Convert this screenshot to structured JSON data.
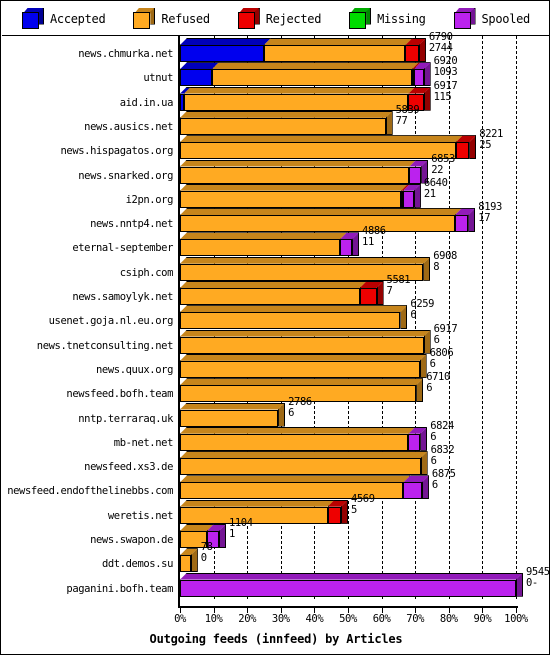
{
  "legend": {
    "items": [
      {
        "label": "Accepted",
        "color": "#0000ee",
        "icon": "cube-icon"
      },
      {
        "label": "Refused",
        "color": "#ffaa22",
        "icon": "cube-icon"
      },
      {
        "label": "Rejected",
        "color": "#ee0000",
        "icon": "cube-icon"
      },
      {
        "label": "Missing",
        "color": "#00dd00",
        "icon": "cube-icon"
      },
      {
        "label": "Spooled",
        "color": "#bb22ee",
        "icon": "cube-icon"
      }
    ]
  },
  "axis": {
    "x_title": "Outgoing feeds (innfeed) by Articles",
    "x_ticks": [
      "0%",
      "10%",
      "20%",
      "30%",
      "40%",
      "50%",
      "60%",
      "70%",
      "80%",
      "90%",
      "100%"
    ]
  },
  "chart_data": {
    "type": "bar",
    "orientation": "horizontal",
    "stacked": true,
    "title": "Outgoing feeds (innfeed) by Articles",
    "xlabel": "Outgoing feeds (innfeed) by Articles",
    "ylabel": "",
    "xlim": [
      0,
      100
    ],
    "xtick_labels": [
      "0%",
      "10%",
      "20%",
      "30%",
      "40%",
      "50%",
      "60%",
      "70%",
      "80%",
      "90%",
      "100%"
    ],
    "xtick_values": [
      0,
      10,
      20,
      30,
      40,
      50,
      60,
      70,
      80,
      90,
      100
    ],
    "grid": true,
    "grid_axis": "x",
    "legend_position": "top",
    "series": [
      {
        "name": "Accepted",
        "color": "#0000ee"
      },
      {
        "name": "Refused",
        "color": "#ffaa22"
      },
      {
        "name": "Rejected",
        "color": "#ee0000"
      },
      {
        "name": "Missing",
        "color": "#00dd00"
      },
      {
        "name": "Spooled",
        "color": "#bb22ee"
      }
    ],
    "categories": [
      "news.chmurka.net",
      "utnut",
      "aid.in.ua",
      "news.ausics.net",
      "news.hispagatos.org",
      "news.snarked.org",
      "i2pn.org",
      "news.nntp4.net",
      "eternal-september",
      "csiph.com",
      "news.samoylyk.net",
      "usenet.goja.nl.eu.org",
      "news.tnetconsulting.net",
      "news.quux.org",
      "newsfeed.bofh.team",
      "nntp.terraraq.uk",
      "mb-net.net",
      "newsfeed.xs3.de",
      "newsfeed.endofthelinebbs.com",
      "weretis.net",
      "news.swapon.de",
      "ddt.demos.su",
      "paganini.bofh.team"
    ],
    "rows": [
      {
        "category": "news.chmurka.net",
        "label_top": "6790",
        "label_bottom": "2744",
        "total_pct": 71.1,
        "segments": [
          {
            "series": "Accepted",
            "pct": 25.0
          },
          {
            "series": "Refused",
            "pct": 42.1
          },
          {
            "series": "Rejected",
            "pct": 4.0
          }
        ]
      },
      {
        "category": "utnut",
        "label_top": "6920",
        "label_bottom": "1093",
        "total_pct": 72.5,
        "segments": [
          {
            "series": "Accepted",
            "pct": 9.5
          },
          {
            "series": "Refused",
            "pct": 59.5
          },
          {
            "series": "Rejected",
            "pct": 0.6
          },
          {
            "series": "Spooled",
            "pct": 2.9
          }
        ]
      },
      {
        "category": "aid.in.ua",
        "label_top": "6917",
        "label_bottom": "115",
        "total_pct": 72.5,
        "segments": [
          {
            "series": "Accepted",
            "pct": 1.2
          },
          {
            "series": "Refused",
            "pct": 66.8
          },
          {
            "series": "Rejected",
            "pct": 4.5
          }
        ]
      },
      {
        "category": "news.ausics.net",
        "label_top": "5839",
        "label_bottom": "77",
        "total_pct": 61.2,
        "segments": [
          {
            "series": "Refused",
            "pct": 61.2
          }
        ]
      },
      {
        "category": "news.hispagatos.org",
        "label_top": "8221",
        "label_bottom": "25",
        "total_pct": 86.1,
        "segments": [
          {
            "series": "Refused",
            "pct": 82.1
          },
          {
            "series": "Rejected",
            "pct": 4.0
          }
        ]
      },
      {
        "category": "news.snarked.org",
        "label_top": "6853",
        "label_bottom": "22",
        "total_pct": 71.8,
        "segments": [
          {
            "series": "Refused",
            "pct": 68.3
          },
          {
            "series": "Spooled",
            "pct": 3.5
          }
        ]
      },
      {
        "category": "i2pn.org",
        "label_top": "6640",
        "label_bottom": "21",
        "total_pct": 69.6,
        "segments": [
          {
            "series": "Refused",
            "pct": 65.8
          },
          {
            "series": "Rejected",
            "pct": 0.6
          },
          {
            "series": "Spooled",
            "pct": 3.2
          }
        ]
      },
      {
        "category": "news.nntp4.net",
        "label_top": "8193",
        "label_bottom": "17",
        "total_pct": 85.8,
        "segments": [
          {
            "series": "Refused",
            "pct": 81.8
          },
          {
            "series": "Spooled",
            "pct": 4.0
          }
        ]
      },
      {
        "category": "eternal-september",
        "label_top": "4886",
        "label_bottom": "11",
        "total_pct": 51.2,
        "segments": [
          {
            "series": "Refused",
            "pct": 47.6
          },
          {
            "series": "Spooled",
            "pct": 3.6
          }
        ]
      },
      {
        "category": "csiph.com",
        "label_top": "6908",
        "label_bottom": "8",
        "total_pct": 72.4,
        "segments": [
          {
            "series": "Refused",
            "pct": 72.4
          }
        ]
      },
      {
        "category": "news.samoylyk.net",
        "label_top": "5581",
        "label_bottom": "7",
        "total_pct": 58.5,
        "segments": [
          {
            "series": "Refused",
            "pct": 53.5
          },
          {
            "series": "Rejected",
            "pct": 5.0
          }
        ]
      },
      {
        "category": "usenet.goja.nl.eu.org",
        "label_top": "6259",
        "label_bottom": "6",
        "total_pct": 65.6,
        "segments": [
          {
            "series": "Refused",
            "pct": 65.6
          }
        ]
      },
      {
        "category": "news.tnetconsulting.net",
        "label_top": "6917",
        "label_bottom": "6",
        "total_pct": 72.5,
        "segments": [
          {
            "series": "Refused",
            "pct": 72.5
          }
        ]
      },
      {
        "category": "news.quux.org",
        "label_top": "6806",
        "label_bottom": "6",
        "total_pct": 71.3,
        "segments": [
          {
            "series": "Refused",
            "pct": 71.3
          }
        ]
      },
      {
        "category": "newsfeed.bofh.team",
        "label_top": "6710",
        "label_bottom": "6",
        "total_pct": 70.3,
        "segments": [
          {
            "series": "Refused",
            "pct": 70.3
          }
        ]
      },
      {
        "category": "nntp.terraraq.uk",
        "label_top": "2786",
        "label_bottom": "6",
        "total_pct": 29.2,
        "segments": [
          {
            "series": "Refused",
            "pct": 29.2
          }
        ]
      },
      {
        "category": "mb-net.net",
        "label_top": "6824",
        "label_bottom": "6",
        "total_pct": 71.5,
        "segments": [
          {
            "series": "Refused",
            "pct": 68.0
          },
          {
            "series": "Spooled",
            "pct": 3.5
          }
        ]
      },
      {
        "category": "newsfeed.xs3.de",
        "label_top": "6832",
        "label_bottom": "6",
        "total_pct": 71.6,
        "segments": [
          {
            "series": "Refused",
            "pct": 71.6
          }
        ]
      },
      {
        "category": "newsfeed.endofthelinebbs.com",
        "label_top": "6875",
        "label_bottom": "6",
        "total_pct": 72.0,
        "segments": [
          {
            "series": "Refused",
            "pct": 66.5
          },
          {
            "series": "Spooled",
            "pct": 5.5
          }
        ]
      },
      {
        "category": "weretis.net",
        "label_top": "4569",
        "label_bottom": "5",
        "total_pct": 47.9,
        "segments": [
          {
            "series": "Refused",
            "pct": 43.9
          },
          {
            "series": "Rejected",
            "pct": 4.0
          }
        ]
      },
      {
        "category": "news.swapon.de",
        "label_top": "1104",
        "label_bottom": "1",
        "total_pct": 11.6,
        "segments": [
          {
            "series": "Refused",
            "pct": 8.0
          },
          {
            "series": "Spooled",
            "pct": 3.6
          }
        ]
      },
      {
        "category": "ddt.demos.su",
        "label_top": "78",
        "label_bottom": "0",
        "total_pct": 3.2,
        "segments": [
          {
            "series": "Refused",
            "pct": 3.2
          }
        ]
      },
      {
        "category": "paganini.bofh.team",
        "label_top": "9545",
        "label_bottom": "0-",
        "total_pct": 100.0,
        "segments": [
          {
            "series": "Spooled",
            "pct": 100.0
          }
        ]
      }
    ]
  }
}
